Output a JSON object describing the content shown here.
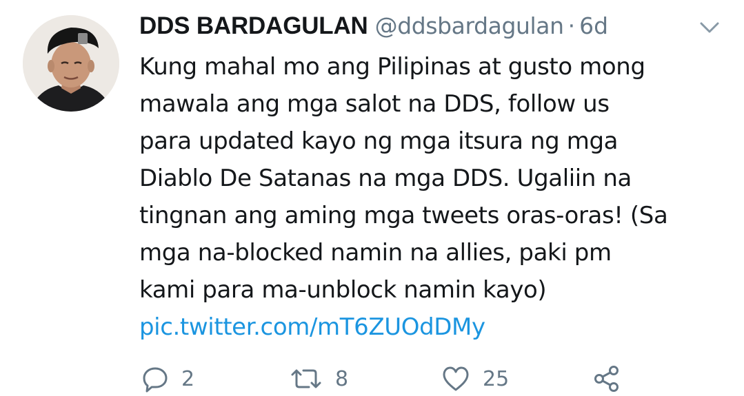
{
  "tweet": {
    "display_name": "DDS BARDAGULAN",
    "handle": "@ddsbardagulan",
    "separator": "·",
    "time": "6d",
    "text_lines": [
      "Kung mahal mo ang Pilipinas at gusto mong",
      "mawala ang mga salot na DDS, follow us",
      "para updated kayo ng mga itsura ng mga",
      "Diablo De Satanas na mga DDS. Ugaliin na",
      "tingnan ang aming mga tweets oras-oras! (Sa",
      "mga na-blocked namin na allies, paki pm",
      "kami para ma-unblock namin kayo)"
    ],
    "link": "pic.twitter.com/mT6ZUOdDMy"
  },
  "actions": {
    "reply_count": "2",
    "retweet_count": "8",
    "like_count": "25"
  },
  "icons": {
    "menu": "chevron-down-icon",
    "reply": "reply-icon",
    "retweet": "retweet-icon",
    "like": "heart-icon",
    "share": "share-icon"
  },
  "colors": {
    "text": "#14171a",
    "secondary": "#657786",
    "link": "#1b95e0"
  }
}
